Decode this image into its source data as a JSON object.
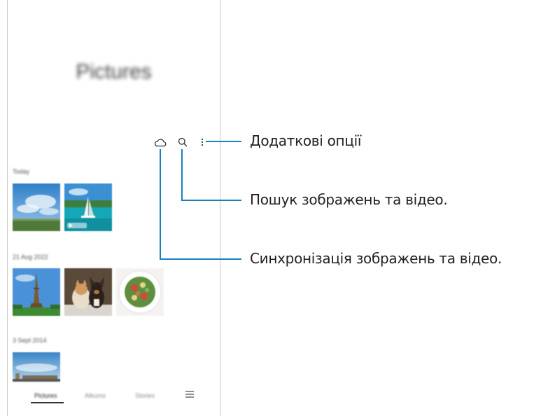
{
  "app": {
    "title": "Pictures"
  },
  "toolbar": {
    "cloud_icon": "cloud-icon",
    "search_icon": "search-icon",
    "more_icon": "more-options-icon"
  },
  "sections": [
    {
      "label": "Today"
    },
    {
      "label": "21 Aug 2022"
    },
    {
      "label": "3 Sept 2014"
    }
  ],
  "bottom_nav": {
    "tabs": [
      "Pictures",
      "Albums",
      "Stories"
    ],
    "active_tab": "Pictures",
    "menu_icon": "menu-icon"
  },
  "callouts": {
    "more_options": "Додаткові опції",
    "search": "Пошук зображень та відео.",
    "sync": "Синхронізація зображень та відео."
  },
  "colors": {
    "callout_line": "#1a7fc1"
  }
}
